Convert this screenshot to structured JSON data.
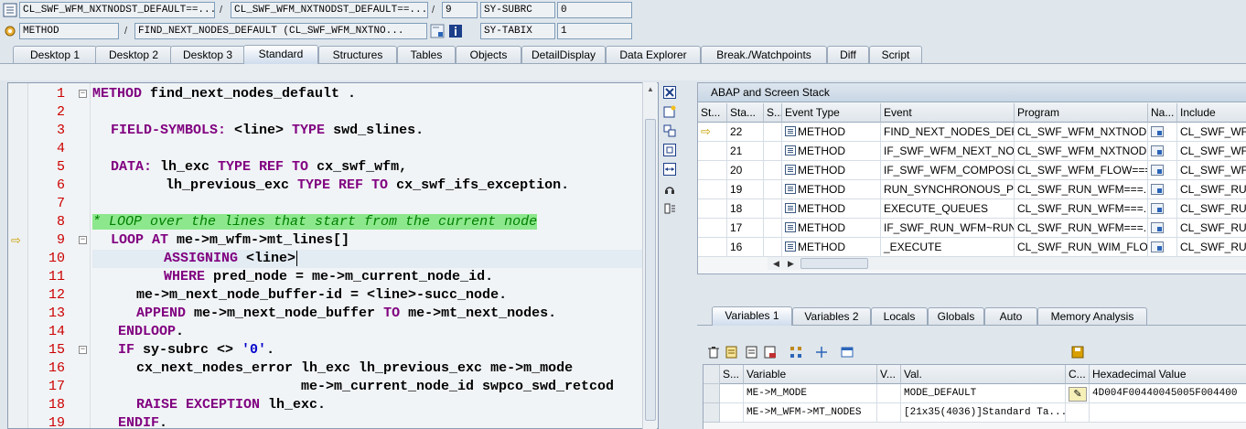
{
  "info_row1": {
    "class_name": "CL_SWF_WFM_NXTNODST_DEFAULT==...",
    "class_name2": "CL_SWF_WFM_NXTNODST_DEFAULT==...",
    "line_no": "9",
    "sysvar_label": "SY-SUBRC",
    "sysvar_value": "0",
    "separator": "/"
  },
  "info_row2": {
    "event_type": "METHOD",
    "event_name": "FIND_NEXT_NODES_DEFAULT (CL_SWF_WFM_NXTNO...",
    "sysvar_label": "SY-TABIX",
    "sysvar_value": "1",
    "separator": "/"
  },
  "tabs": [
    {
      "label": "Desktop 1"
    },
    {
      "label": "Desktop 2"
    },
    {
      "label": "Desktop 3"
    },
    {
      "label": "Standard",
      "active": true
    },
    {
      "label": "Structures"
    },
    {
      "label": "Tables"
    },
    {
      "label": "Objects"
    },
    {
      "label": "DetailDisplay"
    },
    {
      "label": "Data Explorer"
    },
    {
      "label": "Break./Watchpoints"
    },
    {
      "label": "Diff"
    },
    {
      "label": "Script"
    }
  ],
  "code": {
    "lines": [
      {
        "n": "1"
      },
      {
        "n": "2"
      },
      {
        "n": "3"
      },
      {
        "n": "4"
      },
      {
        "n": "5"
      },
      {
        "n": "6"
      },
      {
        "n": "7"
      },
      {
        "n": "8"
      },
      {
        "n": "9"
      },
      {
        "n": "10"
      },
      {
        "n": "11"
      },
      {
        "n": "12"
      },
      {
        "n": "13"
      },
      {
        "n": "14"
      },
      {
        "n": "15"
      },
      {
        "n": "16"
      },
      {
        "n": "17"
      },
      {
        "n": "18"
      },
      {
        "n": "19"
      }
    ],
    "tokens": {
      "l1_kw": "METHOD",
      "l1_rest": " find_next_nodes_default .",
      "l3_kw1": "FIELD-SYMBOLS:",
      "l3_a": " <line> ",
      "l3_kw2": "TYPE",
      "l3_b": " swd_slines.",
      "l5_kw1": "DATA:",
      "l5_a": " lh_exc ",
      "l5_kw2": "TYPE REF TO",
      "l5_b": " cx_swf_wfm,",
      "l6_a": "lh_previous_exc ",
      "l6_kw": "TYPE REF TO",
      "l6_b": " cx_swf_ifs_exception.",
      "l8_comment": "* LOOP over the lines that start from the current node",
      "l9_kw1": "LOOP AT",
      "l9_a": " me->m_wfm->mt_lines[]",
      "l10_kw": "ASSIGNING",
      "l10_a": " <line>",
      "l11_kw": "WHERE",
      "l11_a": " pred_node = me->m_current_node_id.",
      "l12_a": "me->m_next_node_buffer-id = <line>-succ_node.",
      "l13_kw1": "APPEND",
      "l13_a": " me->m_next_node_buffer ",
      "l13_kw2": "TO",
      "l13_b": " me->mt_next_nodes.",
      "l14_kw": "ENDLOOP",
      "l14_a": ".",
      "l15_kw": "IF",
      "l15_a": " sy-subrc <> ",
      "l15_str": "'0'",
      "l15_b": ".",
      "l16_a": "cx_next_nodes_error lh_exc lh_previous_exc me->m_mode",
      "l17_a": "me->m_current_node_id swpco_swd_retcod",
      "l18_kw": "RAISE EXCEPTION",
      "l18_a": " lh_exc.",
      "l19_kw": "ENDIF",
      "l19_a": "."
    }
  },
  "stack": {
    "title": "ABAP and Screen Stack",
    "columns": [
      "St...",
      "Sta...",
      "S...",
      "Event Type",
      "Event",
      "Program",
      "Na...",
      "Include"
    ],
    "rows": [
      {
        "level": "22",
        "type": "METHOD",
        "event": "FIND_NEXT_NODES_DEF...",
        "program": "CL_SWF_WFM_NXTNOD...",
        "include": "CL_SWF_WFM_",
        "current": true
      },
      {
        "level": "21",
        "type": "METHOD",
        "event": "IF_SWF_WFM_NEXT_NO...",
        "program": "CL_SWF_WFM_NXTNOD...",
        "include": "CL_SWF_WFM_"
      },
      {
        "level": "20",
        "type": "METHOD",
        "event": "IF_SWF_WFM_COMPOSI...",
        "program": "CL_SWF_WFM_FLOW===...",
        "include": "CL_SWF_WFM_"
      },
      {
        "level": "19",
        "type": "METHOD",
        "event": "RUN_SYNCHRONOUS_PH...",
        "program": "CL_SWF_RUN_WFM===...",
        "include": "CL_SWF_RUN_"
      },
      {
        "level": "18",
        "type": "METHOD",
        "event": "EXECUTE_QUEUES",
        "program": "CL_SWF_RUN_WFM===...",
        "include": "CL_SWF_RUN_"
      },
      {
        "level": "17",
        "type": "METHOD",
        "event": "IF_SWF_RUN_WFM~RUN",
        "program": "CL_SWF_RUN_WFM===...",
        "include": "CL_SWF_RUN_"
      },
      {
        "level": "16",
        "type": "METHOD",
        "event": "_EXECUTE",
        "program": "CL_SWF_RUN_WIM_FLO...",
        "include": "CL_SWF_RUN_"
      }
    ]
  },
  "var_tabs": [
    {
      "label": "Variables 1",
      "active": true
    },
    {
      "label": "Variables 2"
    },
    {
      "label": "Locals"
    },
    {
      "label": "Globals"
    },
    {
      "label": "Auto"
    },
    {
      "label": "Memory Analysis"
    }
  ],
  "vars": {
    "columns": [
      "S...",
      "Variable",
      "V...",
      "Val.",
      "C...",
      "Hexadecimal Value"
    ],
    "rows": [
      {
        "name": "ME->M_MODE",
        "value": "MODE_DEFAULT",
        "hex": "4D004F00440045005F004400",
        "editable": true
      },
      {
        "name": "ME->M_WFM->MT_NODES",
        "value": "[21x35(4036)]Standard Ta...",
        "hex": ""
      }
    ]
  },
  "colors": {
    "accent": "#cfdced",
    "keyword": "#800080",
    "comment": "#008000",
    "comment_bg": "#8de88d",
    "line_number": "#cc0000"
  }
}
